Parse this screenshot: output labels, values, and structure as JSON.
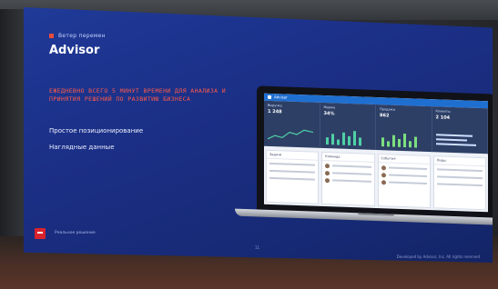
{
  "slide": {
    "eyebrow": "Ветер перемен",
    "title": "Advisor",
    "headline": "ЕЖЕДНЕВНО ВСЕГО 5 МИНУТ ВРЕМЕНИ ДЛЯ АНАЛИЗА И ПРИНЯТИЯ РЕШЕНИЙ ПО РАЗВИТИЮ БИЗНЕСА",
    "bullets": [
      "Простое позиционирование",
      "Наглядные данные"
    ],
    "footer_left": "Реальное решение",
    "page_number": "11",
    "footer_right": "Developed by Advisor, Inc. All rights reserved"
  },
  "laptop_app": {
    "app_title": "Advisor",
    "tiles": [
      {
        "label": "Выручка",
        "value": "1 248"
      },
      {
        "label": "Маржа",
        "value": "34%"
      },
      {
        "label": "Продажи",
        "value": "862"
      },
      {
        "label": "Клиенты",
        "value": "2 104"
      }
    ],
    "panels": [
      "Задачи",
      "Команда",
      "События",
      "Лиды"
    ]
  },
  "colors": {
    "slide_bg": "#1b2f86",
    "accent_red": "#ff5a4a",
    "app_blue": "#1f6fd1"
  }
}
